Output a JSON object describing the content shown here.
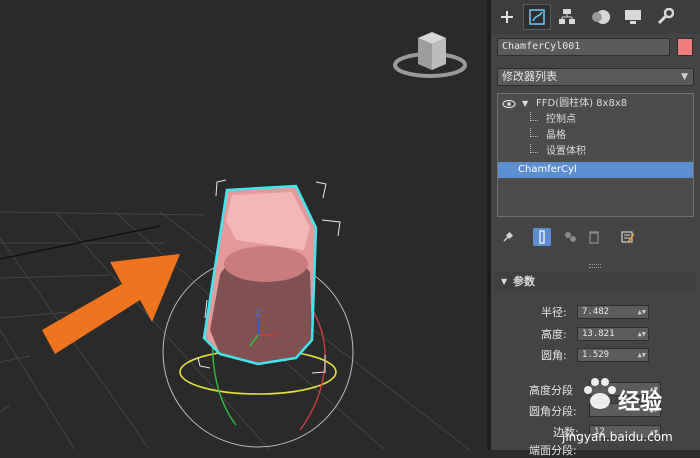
{
  "object_name": "ChamferCyl001",
  "colors": {
    "object_color": "#f07c7c",
    "selection_highlight": "#5c8fcf",
    "wire_cyan": "#3fe6f0",
    "arrow_orange": "#f0741e"
  },
  "command_tabs": [
    {
      "icon": "plus-icon"
    },
    {
      "icon": "modify-icon",
      "active": true
    },
    {
      "icon": "hierarchy-icon"
    },
    {
      "icon": "motion-icon"
    },
    {
      "icon": "display-icon"
    },
    {
      "icon": "utilities-icon"
    }
  ],
  "modifier_list": {
    "label": "修改器列表"
  },
  "stack": {
    "ffd_label": "FFD(圆柱体) 8x8x8",
    "subitems": [
      "控制点",
      "晶格",
      "设置体积"
    ],
    "base_label": "ChamferCyl"
  },
  "stack_toolbar": {
    "icons": [
      "pin-icon",
      "show-end-result-icon",
      "make-unique-icon",
      "remove-modifier-icon",
      "configure-icon"
    ]
  },
  "rollout": {
    "title": "参数"
  },
  "params": {
    "radius": {
      "label": "半径:",
      "value": "7.482"
    },
    "height": {
      "label": "高度:",
      "value": "13.821"
    },
    "fillet": {
      "label": "圆角:",
      "value": "1.529"
    },
    "height_segs": {
      "label": "高度分段"
    },
    "fillet_segs": {
      "label": "圆角分段:"
    },
    "sides": {
      "label": "边数:",
      "value": "12"
    },
    "cap_segs": {
      "label": "端面分段:"
    }
  },
  "watermark": {
    "brand": "经验",
    "url": "jingyan.baidu.com"
  }
}
